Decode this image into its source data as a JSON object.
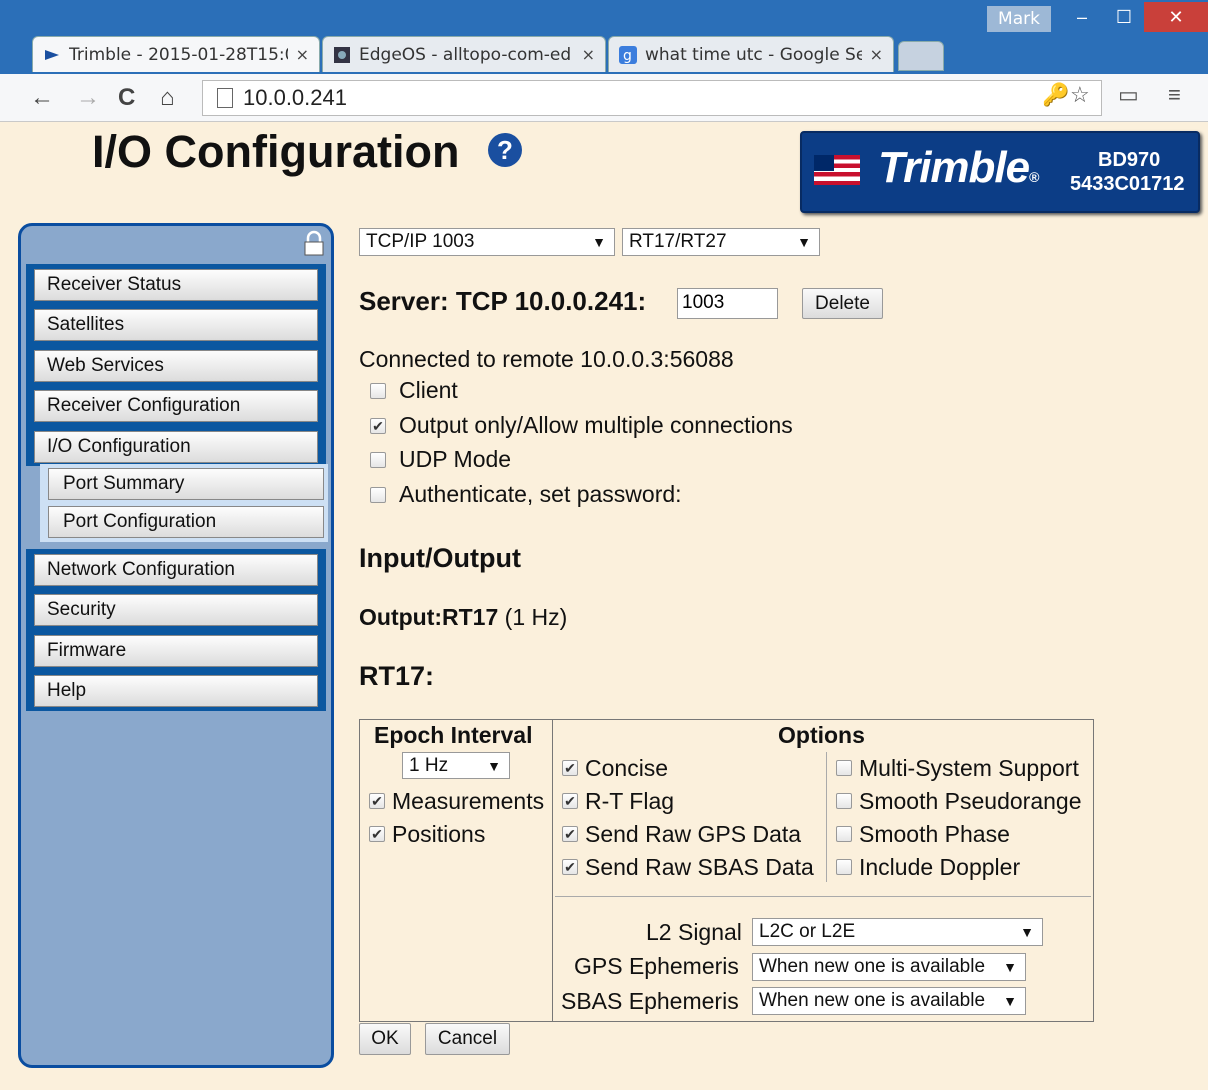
{
  "browser": {
    "user": "Mark",
    "tabs": [
      {
        "title": "Trimble - 2015-01-28T15:0",
        "close": "×"
      },
      {
        "title": "EdgeOS - alltopo-com-ed",
        "close": "×"
      },
      {
        "title": "what time utc - Google Se",
        "close": "×"
      }
    ],
    "url": "10.0.0.241",
    "window_buttons": {
      "minimize": "–",
      "maximize": "☐",
      "close": "✕"
    },
    "nav": {
      "back": "←",
      "forward": "→",
      "reload": "C",
      "home": "⌂"
    },
    "omnibox_icons": {
      "key": "🔑",
      "star": "☆",
      "cast": "▭",
      "menu": "≡"
    }
  },
  "page": {
    "title": "I/O Configuration",
    "help_glyph": "?",
    "brand": {
      "name": "Trimble",
      "mark": "®",
      "model": "BD970",
      "serial": "5433C01712"
    }
  },
  "sidebar": {
    "items": [
      "Receiver Status",
      "Satellites",
      "Web Services",
      "Receiver Configuration",
      "I/O Configuration"
    ],
    "subitems": [
      "Port Summary",
      "Port Configuration"
    ],
    "items2": [
      "Network Configuration",
      "Security",
      "Firmware",
      "Help"
    ]
  },
  "main": {
    "port_select": "TCP/IP 1003",
    "format_select": "RT17/RT27",
    "server_label": "Server: TCP 10.0.0.241:",
    "server_port": "1003",
    "delete_label": "Delete",
    "connected_text": "Connected to remote 10.0.0.3:56088",
    "options": [
      {
        "label": "Client",
        "checked": false
      },
      {
        "label": "Output only/Allow multiple connections",
        "checked": true
      },
      {
        "label": "UDP Mode",
        "checked": false
      },
      {
        "label": "Authenticate, set password:",
        "checked": false
      }
    ],
    "io_heading": "Input/Output",
    "output_label": "Output:RT17",
    "output_rate": "(1 Hz)",
    "rt17_heading": "RT17:",
    "epoch_heading": "Epoch Interval",
    "epoch_value": "1 Hz",
    "epoch_checks": [
      {
        "label": "Measurements",
        "checked": true
      },
      {
        "label": "Positions",
        "checked": true
      }
    ],
    "options_heading": "Options",
    "options_col1": [
      {
        "label": "Concise",
        "checked": true
      },
      {
        "label": "R-T Flag",
        "checked": true
      },
      {
        "label": "Send Raw GPS Data",
        "checked": true
      },
      {
        "label": "Send Raw SBAS Data",
        "checked": true
      }
    ],
    "options_col2": [
      {
        "label": "Multi-System Support",
        "checked": false
      },
      {
        "label": "Smooth Pseudorange",
        "checked": false
      },
      {
        "label": "Smooth Phase",
        "checked": false
      },
      {
        "label": "Include Doppler",
        "checked": false
      }
    ],
    "l2_label": "L2 Signal",
    "l2_value": "L2C or L2E",
    "gps_eph_label": "GPS Ephemeris",
    "gps_eph_value": "When new one is available",
    "sbas_eph_label": "SBAS Ephemeris",
    "sbas_eph_value": "When new one is available",
    "ok_label": "OK",
    "cancel_label": "Cancel"
  }
}
